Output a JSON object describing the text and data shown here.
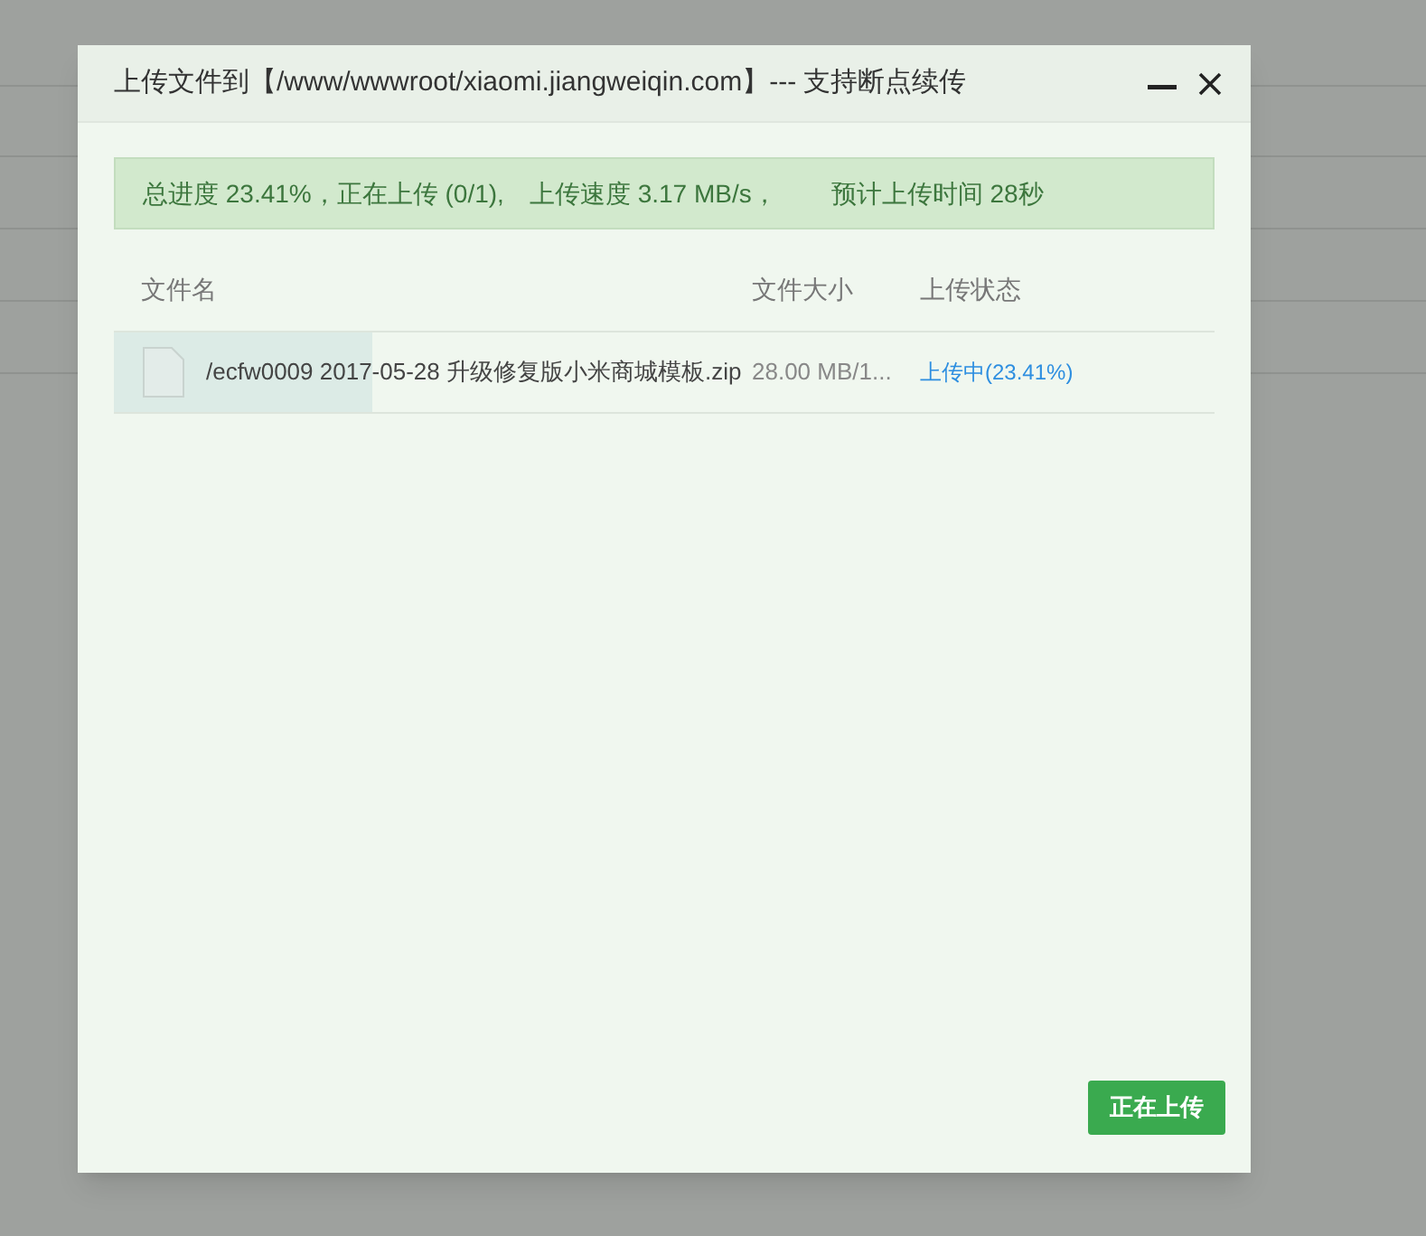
{
  "dialog": {
    "title": "上传文件到【/www/wwwroot/xiaomi.jiangweiqin.com】--- 支持断点续传"
  },
  "summary": {
    "parts": [
      "总进度 23.41%，正在上传 (0/1),",
      "上传速度 3.17 MB/s，",
      "预计上传时间 28秒"
    ]
  },
  "table": {
    "columns": [
      "文件名",
      "文件大小",
      "上传状态"
    ],
    "rows": [
      {
        "name": "/ecfw0009 2017-05-28 升级修复版小米商城模板.zip",
        "size": "28.00 MB/1...",
        "status": "上传中(23.41%)",
        "level": 0.2341
      }
    ]
  },
  "buttons": [
    {
      "label": "正在上传"
    }
  ]
}
